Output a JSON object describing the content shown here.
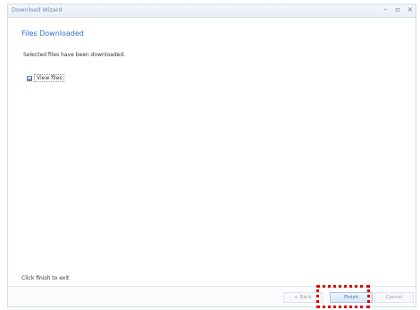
{
  "window": {
    "title": "Download Wizard",
    "controls": {
      "minimize": "–",
      "maximize": "▫",
      "close": "×"
    }
  },
  "page": {
    "heading": "Files Downloaded",
    "description": "Selected files have been downloaded.",
    "view_files_label": "View files",
    "view_files_checked": true,
    "footer_hint": "Click finish to exit"
  },
  "buttons": {
    "back": "< Back",
    "finish": "Finish",
    "cancel": "Cancel"
  },
  "colors": {
    "accent": "#2f6ebd",
    "highlight": "#e00000"
  }
}
